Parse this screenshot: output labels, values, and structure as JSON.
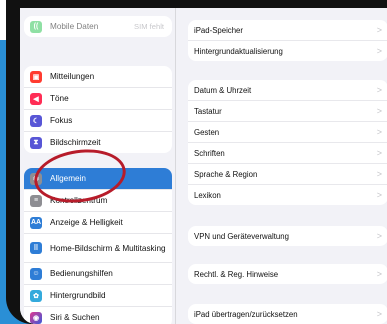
{
  "sidebar": {
    "top_group": [
      {
        "icon": "antenna-icon",
        "color": "#34c759",
        "label": "Mobile Daten",
        "trailing": "SIM fehlt"
      }
    ],
    "group1": [
      {
        "icon": "notifications-icon",
        "color": "#ff3b30",
        "label": "Mitteilungen"
      },
      {
        "icon": "sounds-icon",
        "color": "#ff2d55",
        "label": "Töne"
      },
      {
        "icon": "focus-moon-icon",
        "color": "#5856d6",
        "label": "Fokus"
      },
      {
        "icon": "hourglass-icon",
        "color": "#5856d6",
        "label": "Bildschirmzeit"
      }
    ],
    "group2": [
      {
        "icon": "gear-icon",
        "color": "#8e8e93",
        "label": "Allgemein",
        "selected": true
      },
      {
        "icon": "control-center-icon",
        "color": "#8e8e93",
        "label": "Kontrollzentrum"
      },
      {
        "icon": "display-brightness-icon",
        "color": "#2e7dd6",
        "label": "Anzeige & Helligkeit"
      },
      {
        "icon": "home-screen-icon",
        "color": "#2e7dd6",
        "label": "Home-Bildschirm & Multitasking",
        "tall": true
      },
      {
        "icon": "accessibility-icon",
        "color": "#2e7dd6",
        "label": "Bedienungshilfen"
      },
      {
        "icon": "wallpaper-icon",
        "color": "#34aadc",
        "label": "Hintergrundbild"
      },
      {
        "icon": "siri-icon",
        "color": "#333333",
        "label": "Siri & Suchen"
      }
    ]
  },
  "detail": {
    "group0": [
      {
        "label": "iPad-Speicher"
      },
      {
        "label": "Hintergrundaktualisierung"
      }
    ],
    "group1": [
      {
        "label": "Datum & Uhrzeit"
      },
      {
        "label": "Tastatur"
      },
      {
        "label": "Gesten"
      },
      {
        "label": "Schriften"
      },
      {
        "label": "Sprache & Region"
      },
      {
        "label": "Lexikon"
      }
    ],
    "group2": [
      {
        "label": "VPN und Geräteverwaltung"
      }
    ],
    "group3": [
      {
        "label": "Rechtl. & Reg. Hinweise"
      }
    ],
    "group4": [
      {
        "label": "iPad übertragen/zurücksetzen"
      }
    ]
  },
  "chevron": ">",
  "colors": {
    "accent": "#2e7dd6",
    "annotation": "#b71c2a",
    "background_blue": "#2a8fd6"
  }
}
